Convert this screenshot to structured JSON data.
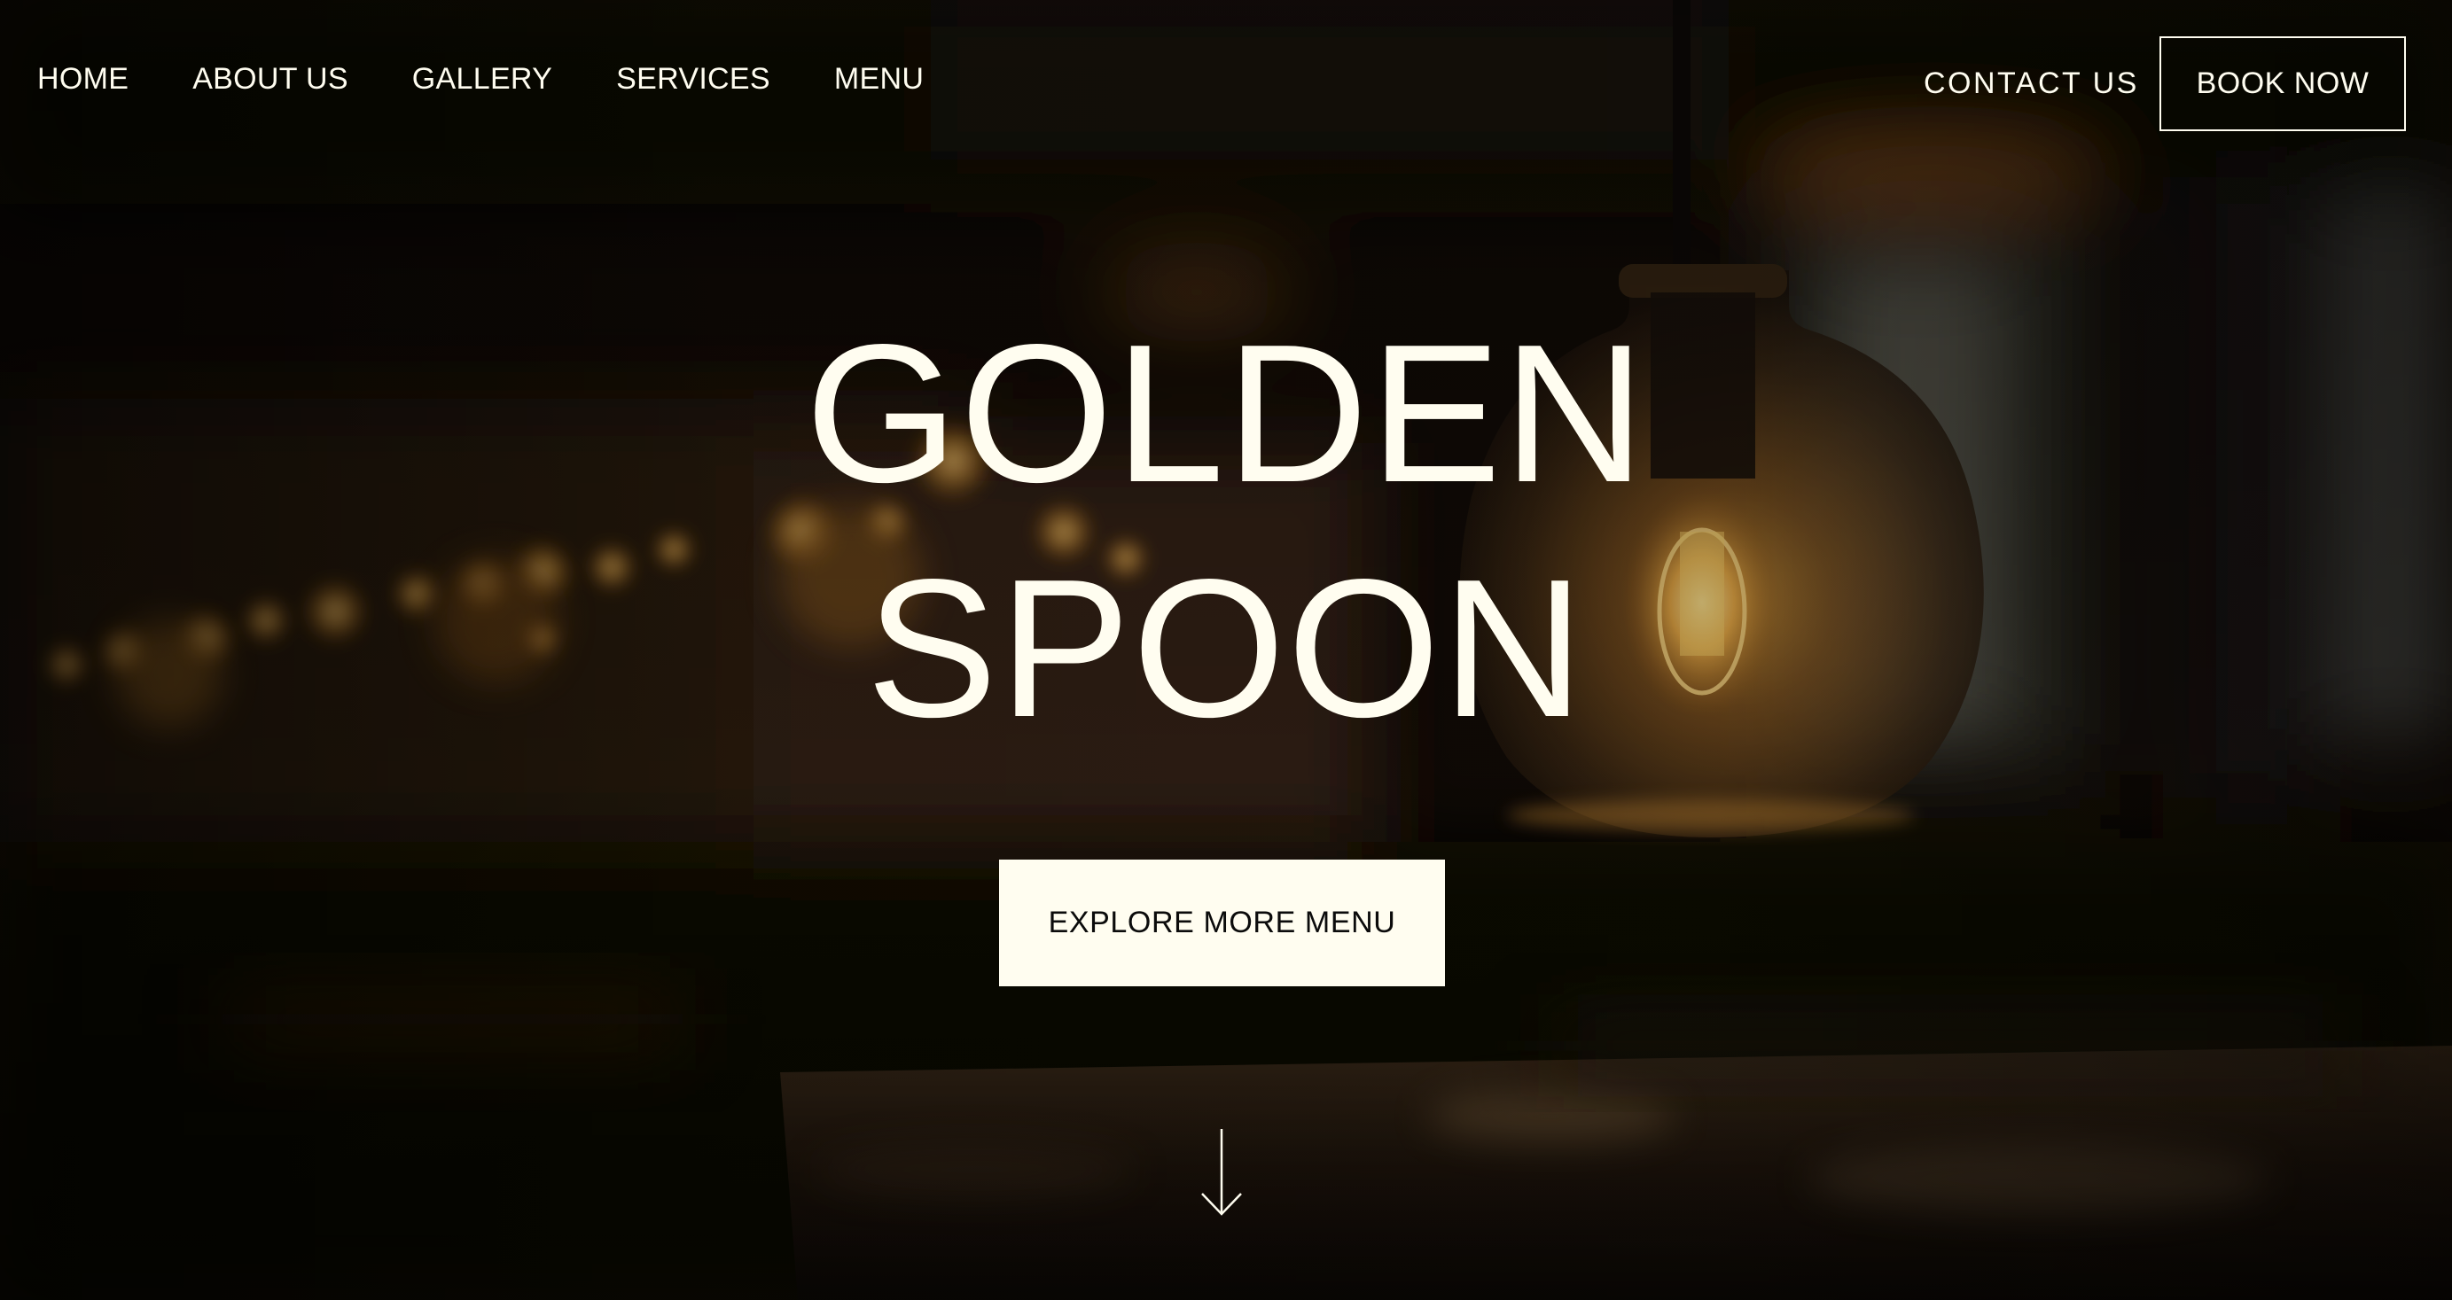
{
  "nav": {
    "links": [
      {
        "label": "HOME"
      },
      {
        "label": "ABOUT US"
      },
      {
        "label": "GALLERY"
      },
      {
        "label": "SERVICES"
      },
      {
        "label": "MENU"
      }
    ],
    "contact_label": "CONTACT US",
    "book_label": "BOOK NOW"
  },
  "hero": {
    "title_line1": "GOLDEN",
    "title_line2": "SPOON",
    "cta_label": "EXPLORE MORE MENU",
    "scroll_icon": "arrow-down-icon",
    "background": "dim restaurant interior with pendant glass lamp and bokeh lights"
  },
  "colors": {
    "text": "#fffdf0",
    "cta_bg": "#fffdf0",
    "cta_text": "#0b0b0b",
    "overlay": "#0a0604",
    "warm_light": "#e0a23a"
  }
}
